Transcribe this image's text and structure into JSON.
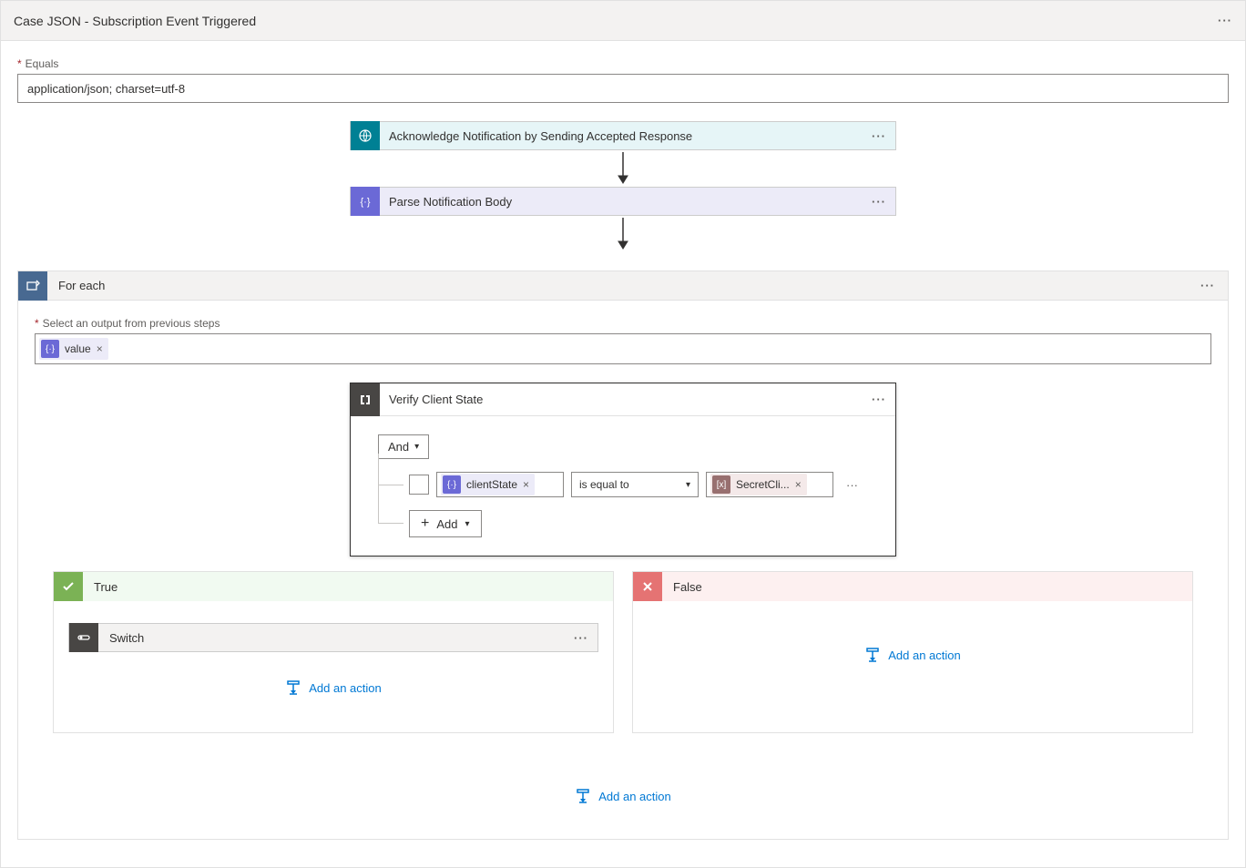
{
  "header": {
    "title": "Case JSON - Subscription Event Triggered"
  },
  "field": {
    "equals_label": "Equals",
    "equals_value": "application/json; charset=utf-8"
  },
  "steps": {
    "ack": "Acknowledge Notification by Sending Accepted Response",
    "parse": "Parse Notification Body"
  },
  "foreach": {
    "title": "For each",
    "select_label": "Select an output from previous steps",
    "token": "value"
  },
  "verify": {
    "title": "Verify Client State",
    "and_label": "And",
    "token1": "clientState",
    "operator": "is equal to",
    "token2": "SecretCli...",
    "add_label": "Add"
  },
  "branches": {
    "true_label": "True",
    "false_label": "False",
    "switch_label": "Switch",
    "add_action": "Add an action"
  }
}
